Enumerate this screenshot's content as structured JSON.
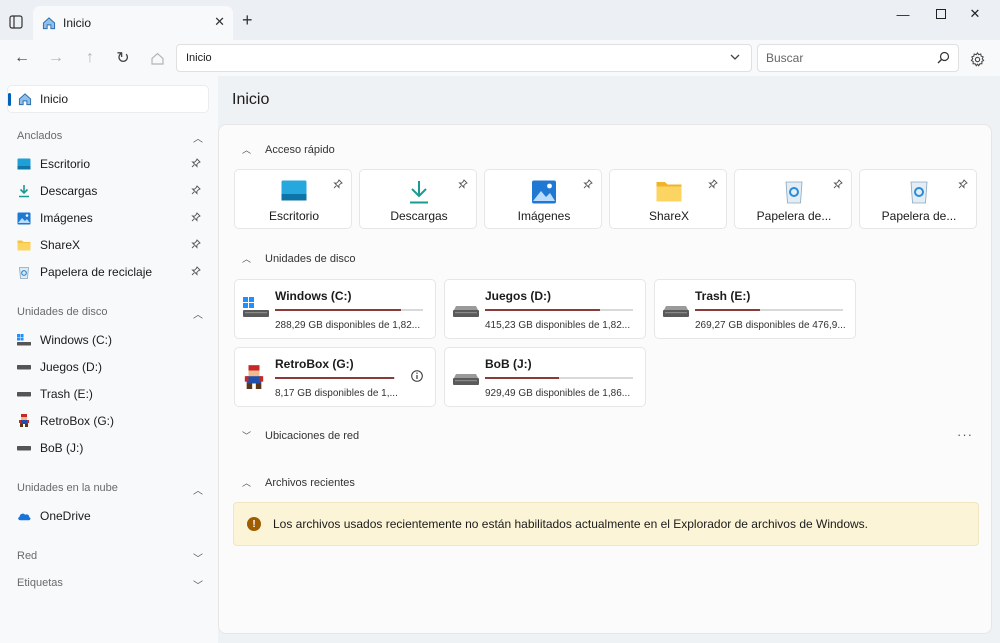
{
  "tab": {
    "title": "Inicio"
  },
  "address": {
    "value": "Inicio"
  },
  "search": {
    "placeholder": "Buscar"
  },
  "sidebar": {
    "home": "Inicio",
    "sections": {
      "pinned": "Anclados",
      "drives": "Unidades de disco",
      "cloud": "Unidades en la nube",
      "network": "Red",
      "tags": "Etiquetas"
    },
    "pinned_items": [
      {
        "label": "Escritorio",
        "icon": "desktop-icon"
      },
      {
        "label": "Descargas",
        "icon": "download-icon"
      },
      {
        "label": "Imágenes",
        "icon": "pictures-icon"
      },
      {
        "label": "ShareX",
        "icon": "folder-icon"
      },
      {
        "label": "Papelera de reciclaje",
        "icon": "recycle-bin-icon"
      }
    ],
    "drive_items": [
      {
        "label": "Windows (C:)",
        "icon": "windows-drive-icon"
      },
      {
        "label": "Juegos (D:)",
        "icon": "drive-icon"
      },
      {
        "label": "Trash (E:)",
        "icon": "drive-icon"
      },
      {
        "label": "RetroBox (G:)",
        "icon": "retrobox-drive-icon"
      },
      {
        "label": "BoB (J:)",
        "icon": "drive-icon"
      }
    ],
    "cloud_items": [
      {
        "label": "OneDrive",
        "icon": "onedrive-icon"
      }
    ]
  },
  "main": {
    "title": "Inicio",
    "sections": {
      "quick_access": "Acceso rápido",
      "drives": "Unidades de disco",
      "network": "Ubicaciones de red",
      "recent": "Archivos recientes"
    },
    "quick_access": [
      {
        "label": "Escritorio",
        "icon": "desktop-icon"
      },
      {
        "label": "Descargas",
        "icon": "download-icon"
      },
      {
        "label": "Imágenes",
        "icon": "pictures-icon"
      },
      {
        "label": "ShareX",
        "icon": "folder-icon"
      },
      {
        "label": "Papelera de...",
        "icon": "recycle-bin-icon"
      },
      {
        "label": "Papelera de...",
        "icon": "recycle-bin-icon"
      }
    ],
    "drives": [
      {
        "name": "Windows (C:)",
        "info": "288,29 GB disponibles de 1,82...",
        "used_fraction": 0.85,
        "icon": "windows-drive-icon"
      },
      {
        "name": "Juegos (D:)",
        "info": "415,23 GB disponibles de 1,82...",
        "used_fraction": 0.78,
        "icon": "drive-icon"
      },
      {
        "name": "Trash (E:)",
        "info": "269,27 GB disponibles de 476,9...",
        "used_fraction": 0.44,
        "icon": "drive-icon"
      },
      {
        "name": "RetroBox (G:)",
        "info": "8,17 GB disponibles de 1,...",
        "used_fraction": 0.99,
        "icon": "retrobox-drive-icon"
      },
      {
        "name": "BoB (J:)",
        "info": "929,49 GB disponibles de 1,86...",
        "used_fraction": 0.5,
        "icon": "drive-icon"
      }
    ],
    "recent_message": "Los archivos usados recientemente no están habilitados actualmente en el Explorador de archivos de Windows."
  },
  "colors": {
    "accent": "#005fb8",
    "usage_bar": "#8b3a3a",
    "warning": "#9d5d00",
    "banner_bg": "#fcf4d6"
  }
}
